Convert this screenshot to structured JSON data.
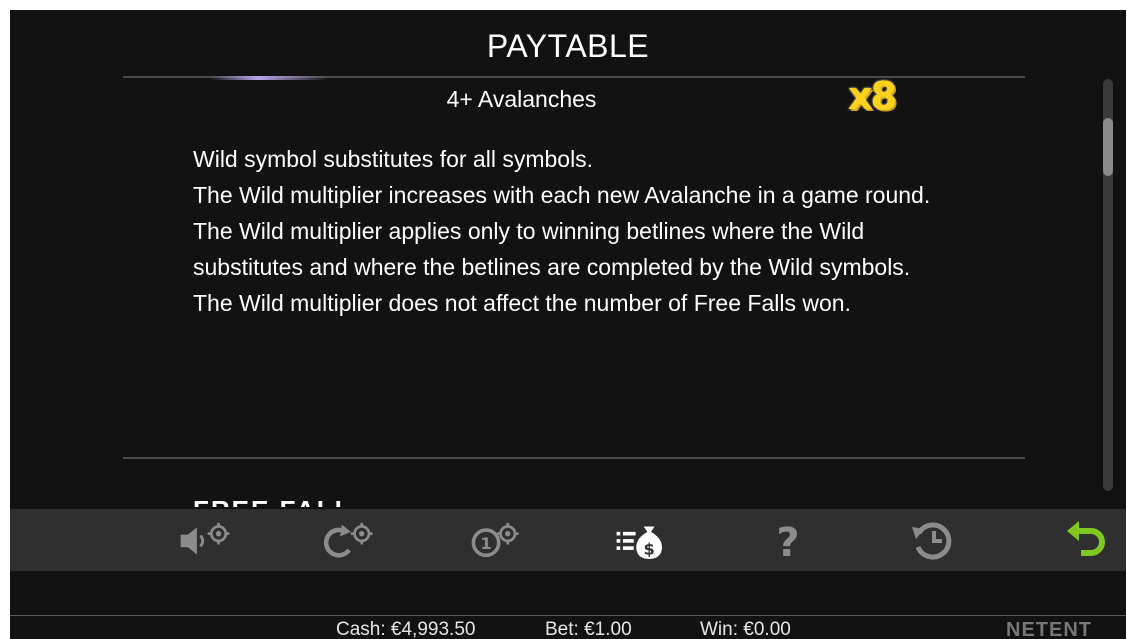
{
  "header": {
    "title": "PAYTABLE"
  },
  "section": {
    "subheading": "4+ Avalanches",
    "multiplier": "x8",
    "paragraphs": [
      "Wild symbol substitutes for all symbols.",
      "The Wild multiplier increases with each new Avalanche in a game round.",
      "The Wild multiplier applies only to winning betlines where the Wild substitutes and where the betlines are completed by the Wild symbols.",
      "The Wild multiplier does not affect the number of Free Falls won."
    ],
    "next_heading": "FREE FALL"
  },
  "toolbar": {
    "buttons": [
      {
        "name": "sound-settings",
        "icon": "speaker-gear-icon",
        "active": false
      },
      {
        "name": "game-settings",
        "icon": "refresh-gear-icon",
        "active": false
      },
      {
        "name": "bet-settings",
        "icon": "coin-gear-icon",
        "active": false
      },
      {
        "name": "paytable",
        "icon": "list-money-bag-icon",
        "active": true
      },
      {
        "name": "help",
        "icon": "question-mark-icon",
        "active": false
      },
      {
        "name": "history",
        "icon": "history-clock-icon",
        "active": false
      },
      {
        "name": "back",
        "icon": "return-arrow-icon",
        "active": false
      }
    ],
    "colors": {
      "inactive": "#8c8c8c",
      "active": "#ffffff",
      "back": "#7ec820"
    }
  },
  "footer": {
    "cash_label": "Cash:",
    "cash_value": "€4,993.50",
    "bet_label": "Bet:",
    "bet_value": "€1.00",
    "win_label": "Win:",
    "win_value": "€0.00",
    "brand": "NETENT"
  }
}
